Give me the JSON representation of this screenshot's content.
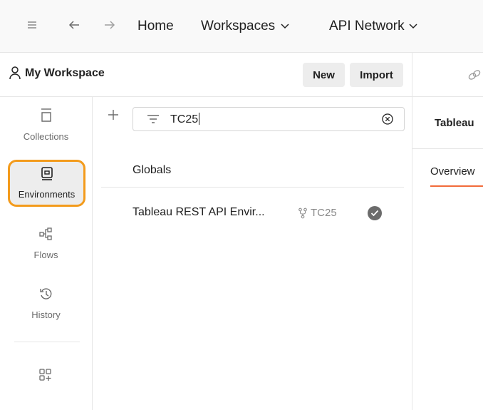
{
  "nav": {
    "home": "Home",
    "workspaces": "Workspaces",
    "api_network": "API Network"
  },
  "workspace": {
    "title": "My Workspace",
    "new_button": "New",
    "import_button": "Import"
  },
  "sidebar": {
    "items": [
      {
        "label": "Collections",
        "icon": "collections-icon",
        "active": false
      },
      {
        "label": "Environments",
        "icon": "environments-icon",
        "active": true
      },
      {
        "label": "Flows",
        "icon": "flows-icon",
        "active": false
      },
      {
        "label": "History",
        "icon": "history-icon",
        "active": false
      }
    ]
  },
  "search": {
    "value": "TC25"
  },
  "environments": {
    "globals": "Globals",
    "items": [
      {
        "name": "Tableau REST API Envir...",
        "fork_label": "TC25",
        "active": true
      }
    ]
  },
  "detail": {
    "title": "Tableau",
    "tab_overview": "Overview"
  },
  "colors": {
    "accent_orange": "#f39b1c",
    "tab_underline": "#f26b3a"
  }
}
